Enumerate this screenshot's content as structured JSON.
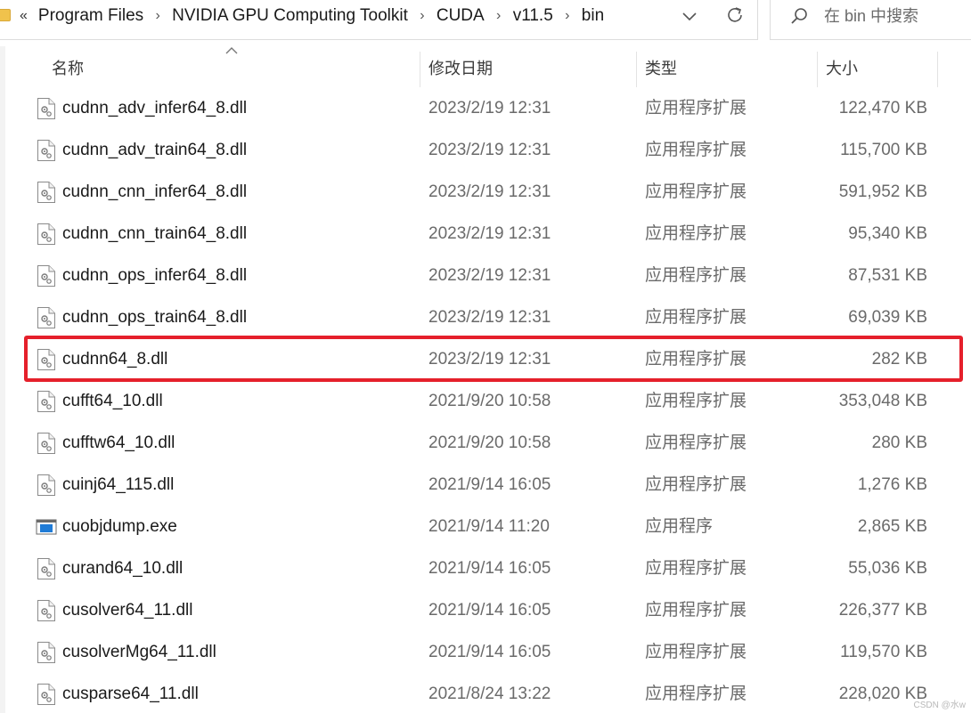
{
  "address": {
    "more": "«",
    "crumbs": [
      "Program Files",
      "NVIDIA GPU Computing Toolkit",
      "CUDA",
      "v11.5",
      "bin"
    ],
    "separator": "›"
  },
  "search": {
    "placeholder": "在 bin 中搜索"
  },
  "columns": {
    "name": "名称",
    "date": "修改日期",
    "type": "类型",
    "size": "大小"
  },
  "files": [
    {
      "name": "cudnn_adv_infer64_8.dll",
      "date": "2023/2/19 12:31",
      "type": "应用程序扩展",
      "size": "122,470 KB",
      "icon": "dll-file-icon"
    },
    {
      "name": "cudnn_adv_train64_8.dll",
      "date": "2023/2/19 12:31",
      "type": "应用程序扩展",
      "size": "115,700 KB",
      "icon": "dll-file-icon"
    },
    {
      "name": "cudnn_cnn_infer64_8.dll",
      "date": "2023/2/19 12:31",
      "type": "应用程序扩展",
      "size": "591,952 KB",
      "icon": "dll-file-icon"
    },
    {
      "name": "cudnn_cnn_train64_8.dll",
      "date": "2023/2/19 12:31",
      "type": "应用程序扩展",
      "size": "95,340 KB",
      "icon": "dll-file-icon"
    },
    {
      "name": "cudnn_ops_infer64_8.dll",
      "date": "2023/2/19 12:31",
      "type": "应用程序扩展",
      "size": "87,531 KB",
      "icon": "dll-file-icon"
    },
    {
      "name": "cudnn_ops_train64_8.dll",
      "date": "2023/2/19 12:31",
      "type": "应用程序扩展",
      "size": "69,039 KB",
      "icon": "dll-file-icon"
    },
    {
      "name": "cudnn64_8.dll",
      "date": "2023/2/19 12:31",
      "type": "应用程序扩展",
      "size": "282 KB",
      "icon": "dll-file-icon",
      "highlighted": true
    },
    {
      "name": "cufft64_10.dll",
      "date": "2021/9/20 10:58",
      "type": "应用程序扩展",
      "size": "353,048 KB",
      "icon": "dll-file-icon"
    },
    {
      "name": "cufftw64_10.dll",
      "date": "2021/9/20 10:58",
      "type": "应用程序扩展",
      "size": "280 KB",
      "icon": "dll-file-icon"
    },
    {
      "name": "cuinj64_115.dll",
      "date": "2021/9/14 16:05",
      "type": "应用程序扩展",
      "size": "1,276 KB",
      "icon": "dll-file-icon"
    },
    {
      "name": "cuobjdump.exe",
      "date": "2021/9/14 11:20",
      "type": "应用程序",
      "size": "2,865 KB",
      "icon": "exe-file-icon"
    },
    {
      "name": "curand64_10.dll",
      "date": "2021/9/14 16:05",
      "type": "应用程序扩展",
      "size": "55,036 KB",
      "icon": "dll-file-icon"
    },
    {
      "name": "cusolver64_11.dll",
      "date": "2021/9/14 16:05",
      "type": "应用程序扩展",
      "size": "226,377 KB",
      "icon": "dll-file-icon"
    },
    {
      "name": "cusolverMg64_11.dll",
      "date": "2021/9/14 16:05",
      "type": "应用程序扩展",
      "size": "119,570 KB",
      "icon": "dll-file-icon"
    },
    {
      "name": "cusparse64_11.dll",
      "date": "2021/8/24 13:22",
      "type": "应用程序扩展",
      "size": "228,020 KB",
      "icon": "dll-file-icon"
    }
  ],
  "watermark": "CSDN @水w",
  "colors": {
    "highlight": "#e5202b",
    "folder": "#f0c24c"
  }
}
